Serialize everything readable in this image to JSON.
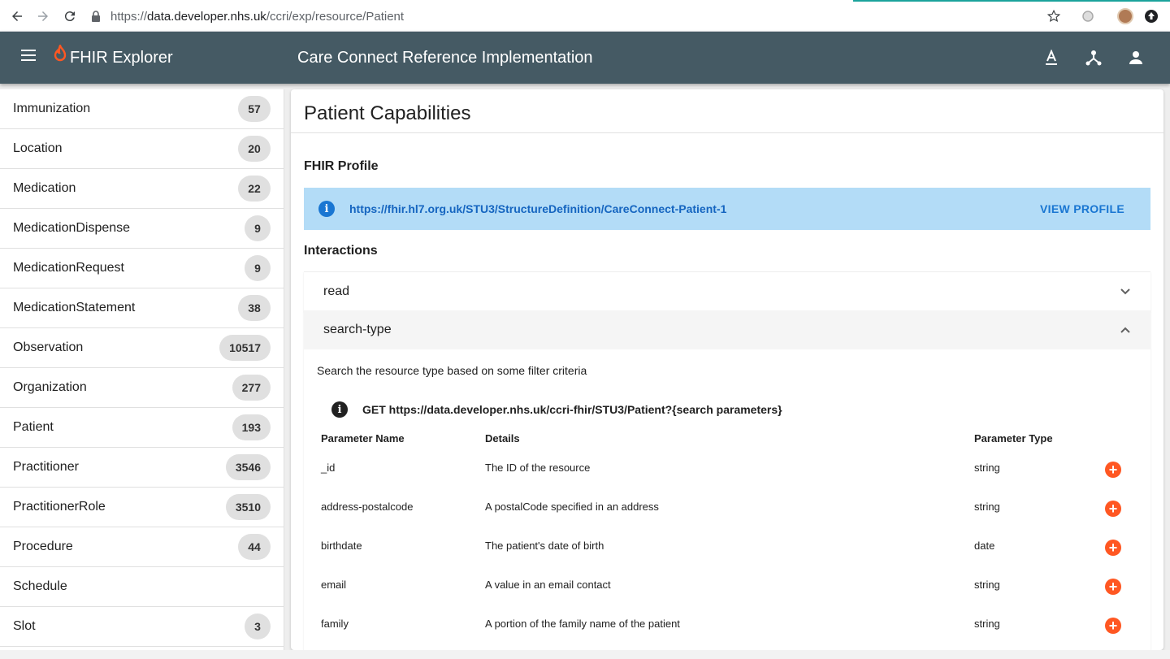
{
  "browser": {
    "url_prefix": "https://",
    "url_host": "data.developer.nhs.uk",
    "url_path": "/ccri/exp/resource/Patient"
  },
  "appbar": {
    "app_title": "FHIR Explorer",
    "page_heading": "Care Connect Reference Implementation"
  },
  "sidebar": {
    "items": [
      {
        "label": "Immunization",
        "count": "57"
      },
      {
        "label": "Location",
        "count": "20"
      },
      {
        "label": "Medication",
        "count": "22"
      },
      {
        "label": "MedicationDispense",
        "count": "9"
      },
      {
        "label": "MedicationRequest",
        "count": "9"
      },
      {
        "label": "MedicationStatement",
        "count": "38"
      },
      {
        "label": "Observation",
        "count": "10517"
      },
      {
        "label": "Organization",
        "count": "277"
      },
      {
        "label": "Patient",
        "count": "193"
      },
      {
        "label": "Practitioner",
        "count": "3546"
      },
      {
        "label": "PractitionerRole",
        "count": "3510"
      },
      {
        "label": "Procedure",
        "count": "44"
      },
      {
        "label": "Schedule",
        "count": ""
      },
      {
        "label": "Slot",
        "count": "3"
      }
    ]
  },
  "main": {
    "title": "Patient Capabilities",
    "profile_section": "FHIR Profile",
    "profile_url": "https://fhir.hl7.org.uk/STU3/StructureDefinition/CareConnect-Patient-1",
    "view_profile_label": "VIEW PROFILE",
    "interactions_section": "Interactions",
    "panels": {
      "read": "read",
      "search_type": "search-type"
    },
    "search_description": "Search the resource type based on some filter criteria",
    "get_line": "GET https://data.developer.nhs.uk/ccri-fhir/STU3/Patient?{search parameters}",
    "table": {
      "headers": {
        "name": "Parameter Name",
        "details": "Details",
        "type": "Parameter Type"
      },
      "rows": [
        {
          "name": "_id",
          "details": "The ID of the resource",
          "type": "string"
        },
        {
          "name": "address-postalcode",
          "details": "A postalCode specified in an address",
          "type": "string"
        },
        {
          "name": "birthdate",
          "details": "The patient's date of birth",
          "type": "date"
        },
        {
          "name": "email",
          "details": "A value in an email contact",
          "type": "string"
        },
        {
          "name": "family",
          "details": "A portion of the family name of the patient",
          "type": "string"
        }
      ]
    }
  },
  "colors": {
    "appbar": "#455a64",
    "banner": "#b3dcf7",
    "link": "#1565c0",
    "add_button": "#ff5722",
    "flame": "#ff5722"
  },
  "icons": [
    "back-arrow-icon",
    "forward-arrow-icon",
    "reload-icon",
    "lock-icon",
    "star-icon",
    "menu-icon",
    "flame-icon",
    "text-format-icon",
    "device-hub-icon",
    "account-icon",
    "info-icon",
    "chevron-down-icon",
    "chevron-up-icon",
    "add-circle-icon"
  ]
}
